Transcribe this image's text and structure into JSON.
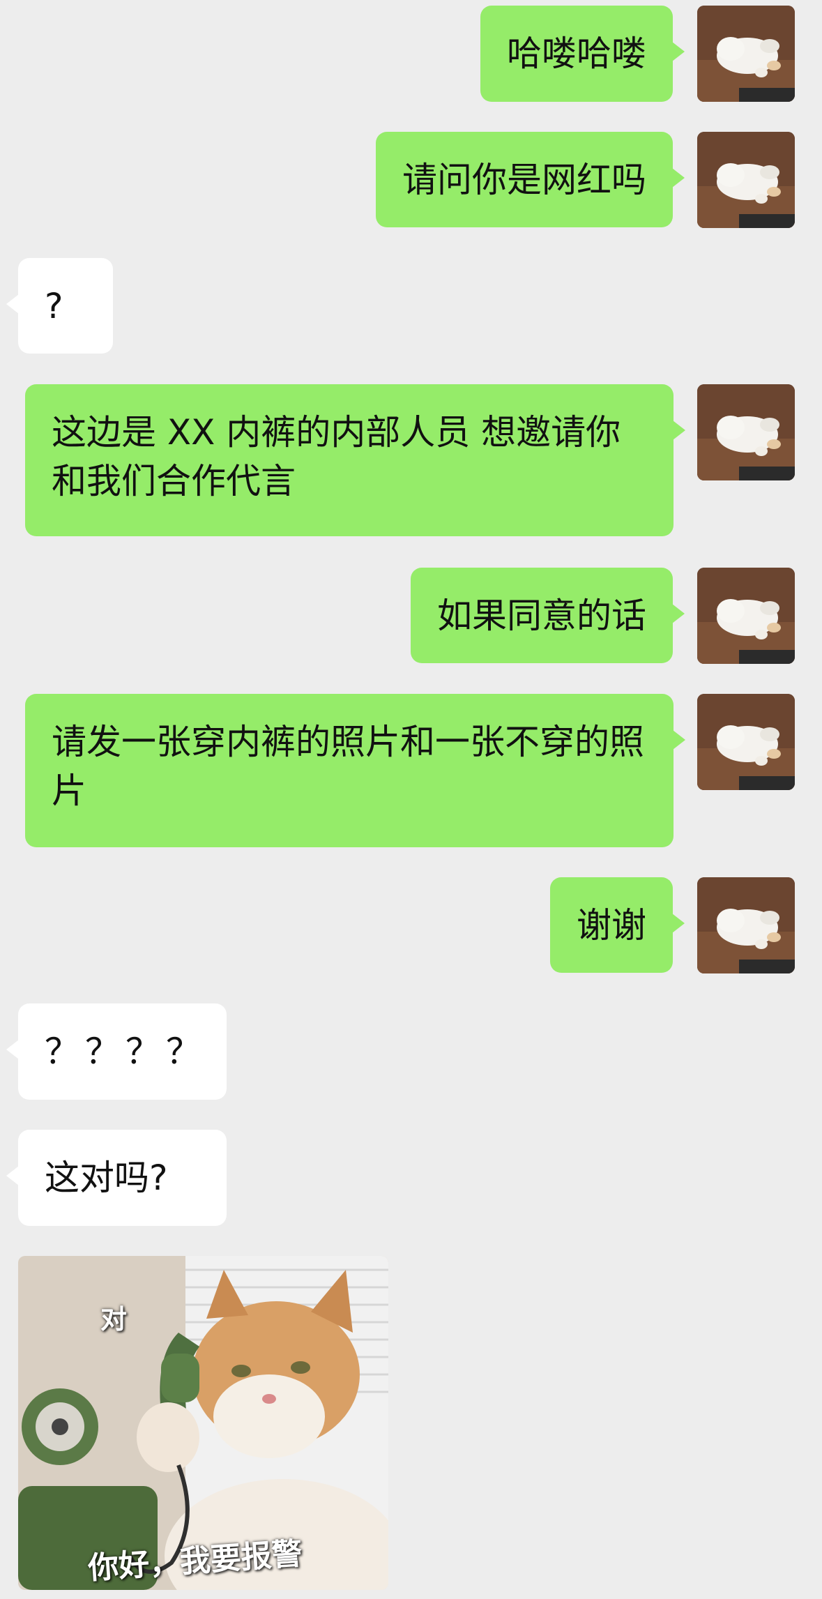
{
  "messages": [
    {
      "sender": "me",
      "text": "哈喽哈喽"
    },
    {
      "sender": "me",
      "text": "请问你是网红吗"
    },
    {
      "sender": "them",
      "text": "?"
    },
    {
      "sender": "me",
      "text": "这边是 XX 内裤的内部人员 想邀请你和我们合作代言"
    },
    {
      "sender": "me",
      "text": "如果同意的话"
    },
    {
      "sender": "me",
      "text": "请发一张穿内裤的照片和一张不穿的照片"
    },
    {
      "sender": "me",
      "text": "谢谢"
    },
    {
      "sender": "them",
      "text": "？？？？"
    },
    {
      "sender": "them",
      "text": "这对吗?"
    }
  ],
  "sticker": {
    "top_text": "对",
    "bottom_text": "你好，我要报警"
  },
  "colors": {
    "background": "#ededed",
    "my_bubble": "#95ec69",
    "their_bubble": "#ffffff"
  },
  "icons": {
    "avatar": "sleeping-white-cat-avatar",
    "sticker": "cat-holding-phone-sticker"
  }
}
